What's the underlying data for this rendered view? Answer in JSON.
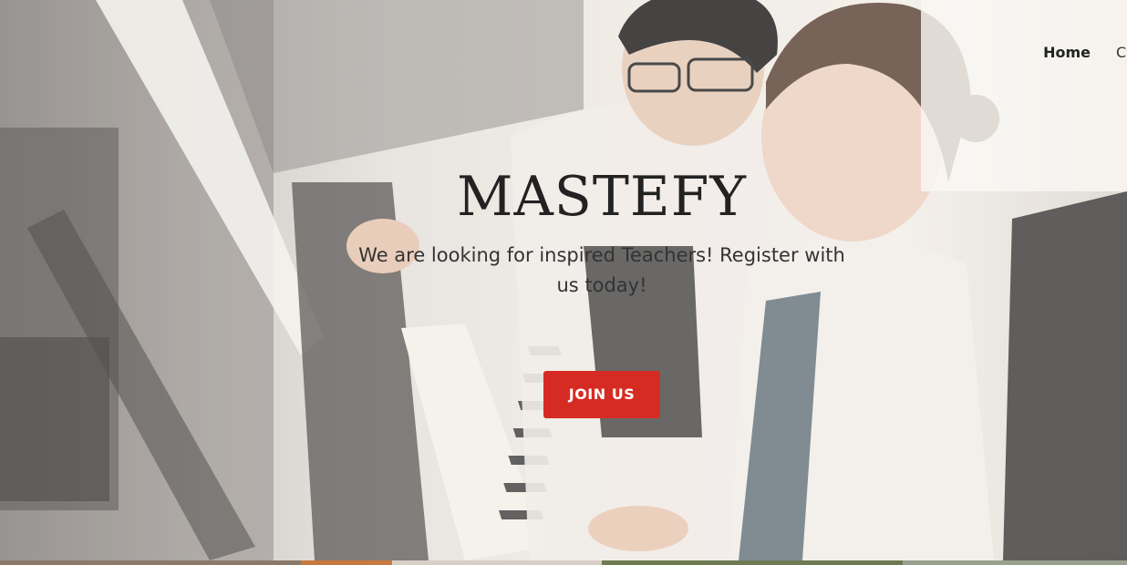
{
  "nav": {
    "items": [
      {
        "label": "Home"
      },
      {
        "label": "C"
      }
    ]
  },
  "hero": {
    "title": "MASTEFY",
    "tagline": "We are looking for inspired Teachers! Register with us today!",
    "cta_label": "JOIN US"
  },
  "colors": {
    "cta": "#d62b22",
    "text_dark": "#222222"
  }
}
